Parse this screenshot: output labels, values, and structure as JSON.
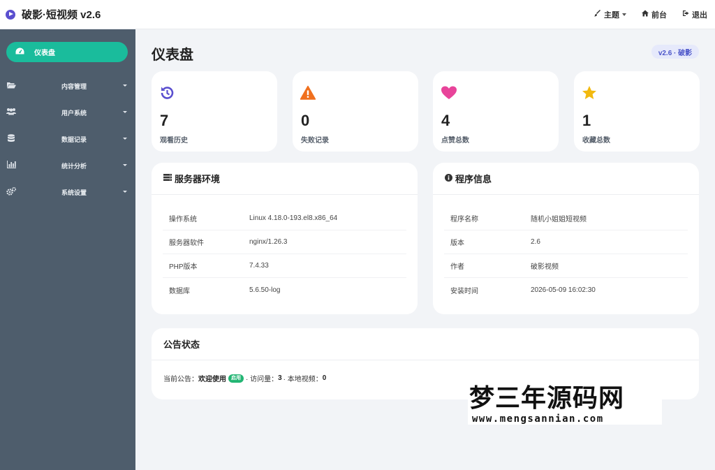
{
  "app": {
    "title": "破影·短视频 v2.6",
    "accent": "#5a4fcf"
  },
  "topbar": {
    "theme_label": "主题",
    "frontend_label": "前台",
    "logout_label": "退出"
  },
  "sidebar": {
    "items": [
      {
        "label": "仪表盘",
        "icon": "dashboard-icon",
        "active": true
      },
      {
        "label": "内容管理",
        "icon": "folder-open-icon"
      },
      {
        "label": "用户系统",
        "icon": "users-icon"
      },
      {
        "label": "数据记录",
        "icon": "database-icon"
      },
      {
        "label": "统计分析",
        "icon": "bar-chart-icon"
      },
      {
        "label": "系统设置",
        "icon": "cogs-icon"
      }
    ]
  },
  "main": {
    "page_title": "仪表盘",
    "version_badge": "v2.6 · 破影",
    "stats": [
      {
        "value": "7",
        "label": "观看历史",
        "icon": "history-icon",
        "color": "#5a4fcf"
      },
      {
        "value": "0",
        "label": "失败记录",
        "icon": "warning-icon",
        "color": "#f0701e"
      },
      {
        "value": "4",
        "label": "点赞总数",
        "icon": "heart-icon",
        "color": "#e8449a"
      },
      {
        "value": "1",
        "label": "收藏总数",
        "icon": "star-icon",
        "color": "#f2b90f"
      }
    ],
    "server_panel": {
      "title": "服务器环境",
      "rows": [
        {
          "key": "操作系统",
          "value": "Linux 4.18.0-193.el8.x86_64"
        },
        {
          "key": "服务器软件",
          "value": "nginx/1.26.3"
        },
        {
          "key": "PHP版本",
          "value": "7.4.33"
        },
        {
          "key": "数据库",
          "value": "5.6.50-log"
        }
      ]
    },
    "program_panel": {
      "title": "程序信息",
      "rows": [
        {
          "key": "程序名称",
          "value": "随机小姐姐短视频"
        },
        {
          "key": "版本",
          "value": "2.6"
        },
        {
          "key": "作者",
          "value": "破影视频"
        },
        {
          "key": "安装时间",
          "value": "2026-05-09 16:02:30"
        }
      ]
    },
    "notice_panel": {
      "title": "公告状态",
      "prefix": "当前公告：",
      "notice_title": "欢迎使用",
      "status_badge": "启用",
      "visits_label": "· 访问量：",
      "visits_value": "3",
      "videos_label": "· 本地视频：",
      "videos_value": "0"
    }
  },
  "watermark": {
    "text": "梦三年源码网",
    "url": "www.mengsannian.com"
  }
}
